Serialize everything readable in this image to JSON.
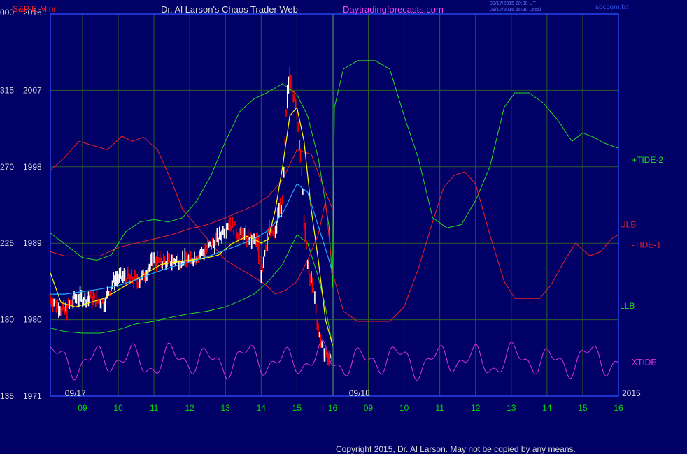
{
  "header": {
    "symbol": "S&P E-Mini",
    "title": "Dr. Al Larson's Chaos Trader Web",
    "site": "Daytradingforecasts.com",
    "timestamp_utc": "09/17/2015 20:30 UT",
    "timestamp_local": "09/17/2015 15:30 Local",
    "filename": "spccom.txt"
  },
  "footer": {
    "copyright": "Copyright 2015, Dr. Al Larson. May not be copied by any means."
  },
  "colors": {
    "background": "#000066",
    "grid": "#2e5b2e",
    "frame": "#2244ee",
    "price_up": "#ffffff",
    "price_down": "#ff0000",
    "tide_plus": "#22dd22",
    "tide_minus": "#ee2222",
    "xtide": "#dd33dd",
    "ulb": "#ee2222",
    "llb": "#22dd22",
    "ma_slow": "#ffff00",
    "ma_fast": "#22aaff",
    "axis_text": "#dddddd",
    "hour_text": "#00dd00",
    "title_text": "#dddddd",
    "symbol_text": "#ff2222",
    "site_text": "#ff44ff"
  },
  "chart_data": {
    "type": "line",
    "title": "Dr. Al Larson's Chaos Trader Web",
    "y_left_outer": [
      {
        "label": "000",
        "price": 2016
      },
      {
        "label": "315",
        "price": 2007
      },
      {
        "label": "270",
        "price": 1998
      },
      {
        "label": "225",
        "price": 1989
      },
      {
        "label": "180",
        "price": 1980
      },
      {
        "label": "135",
        "price": 1971
      }
    ],
    "y_ticks": [
      2016,
      2007,
      1998,
      1989,
      1980,
      1971
    ],
    "ylim": [
      1971,
      2016
    ],
    "x_hours": [
      "09",
      "10",
      "11",
      "12",
      "13",
      "14",
      "15",
      "16",
      "09",
      "10",
      "11",
      "12",
      "13",
      "14",
      "15",
      "16"
    ],
    "x_hours_pos": [
      1,
      2,
      3,
      4,
      5,
      6,
      7,
      8,
      9,
      10,
      11,
      12,
      13,
      14,
      15,
      16
    ],
    "xlim": [
      0.1,
      16.0
    ],
    "day_labels": [
      {
        "label": "09/17",
        "x": 0.8
      },
      {
        "label": "09/18",
        "x": 8.75
      }
    ],
    "day_divider_x": 8.02,
    "year_label": "2015",
    "series": [
      {
        "name": "+TIDE-2",
        "color": "#22dd22",
        "x": [
          0.1,
          0.6,
          1.0,
          1.4,
          1.8,
          2.2,
          2.6,
          3.0,
          3.4,
          3.8,
          4.2,
          4.6,
          5.0,
          5.4,
          5.8,
          6.2,
          6.6,
          7.0,
          7.3,
          7.6,
          7.9,
          8.0,
          8.05,
          8.3,
          8.7,
          9.2,
          9.6,
          10.0,
          10.4,
          10.8,
          11.2,
          11.6,
          12.0,
          12.4,
          12.8,
          13.1,
          13.5,
          13.9,
          14.3,
          14.7,
          15.0,
          15.3,
          15.6,
          16.0
        ],
        "y": [
          1990.2,
          1988.6,
          1987.3,
          1987.0,
          1987.6,
          1990.3,
          1991.5,
          1991.8,
          1991.5,
          1992.0,
          1994.0,
          1997.0,
          2001.0,
          2004.5,
          2006.0,
          2006.8,
          2007.8,
          2006.5,
          2004.0,
          1999.0,
          1991.0,
          1983.8,
          2005.0,
          2009.5,
          2010.5,
          2010.5,
          2009.5,
          2004.0,
          1999.0,
          1992.0,
          1990.8,
          1991.2,
          1994.0,
          1998.0,
          2005.0,
          2006.7,
          2006.7,
          2005.5,
          2003.5,
          2001.0,
          2002.0,
          2001.5,
          2000.8,
          2000.2
        ]
      },
      {
        "name": "-TIDE-1",
        "color": "#ee2222",
        "x": [
          0.1,
          0.5,
          0.9,
          1.3,
          1.7,
          2.1,
          2.4,
          2.7,
          3.1,
          3.5,
          3.8,
          4.2,
          4.6,
          5.0,
          5.4,
          5.8,
          6.1,
          6.4,
          6.7,
          7.0,
          7.3,
          7.6,
          7.8,
          8.0,
          8.3,
          8.7,
          9.2,
          9.6,
          10.0,
          10.4,
          10.8,
          11.1,
          11.4,
          11.7,
          12.0,
          12.4,
          12.8,
          13.1,
          13.5,
          13.8,
          14.1,
          14.5,
          14.8,
          15.2,
          15.5,
          15.8,
          16.0
        ],
        "y": [
          1997.6,
          1999.1,
          2001.0,
          2000.5,
          2000.0,
          2001.6,
          2001.0,
          2001.5,
          2000.0,
          1996.2,
          1993.0,
          1991.0,
          1989.0,
          1987.0,
          1986.0,
          1985.0,
          1984.2,
          1983.0,
          1983.5,
          1984.5,
          1987.0,
          1990.0,
          1994.0,
          1985.5,
          1981.0,
          1979.8,
          1979.8,
          1979.8,
          1981.5,
          1986.0,
          1991.5,
          1995.5,
          1997.0,
          1997.4,
          1996.0,
          1990.0,
          1984.5,
          1982.5,
          1982.5,
          1982.5,
          1984.0,
          1987.0,
          1989.0,
          1987.5,
          1988.0,
          1989.5,
          1990.0
        ]
      },
      {
        "name": "XTIDE",
        "color": "#dd33dd",
        "shape": "oscillator",
        "baseline": 1975.2,
        "amplitude": 2.4,
        "x_start": 0.1,
        "x_end": 16.0
      },
      {
        "name": "ULB",
        "color": "#ee2222",
        "x": [
          0.1,
          0.5,
          1.0,
          1.5,
          2.0,
          2.5,
          3.0,
          3.5,
          4.0,
          4.5,
          5.0,
          5.4,
          5.8,
          6.2,
          6.6,
          7.0,
          7.4,
          7.8,
          8.0
        ],
        "y": [
          1988.0,
          1987.5,
          1987.5,
          1987.5,
          1988.5,
          1989.0,
          1989.5,
          1990.0,
          1990.7,
          1991.2,
          1992.0,
          1992.7,
          1993.4,
          1994.5,
          1996.5,
          2000.0,
          1999.5,
          1995.0,
          1993.0
        ]
      },
      {
        "name": "LLB",
        "color": "#22dd22",
        "x": [
          0.1,
          0.5,
          1.0,
          1.5,
          2.0,
          2.5,
          3.0,
          3.5,
          4.0,
          4.5,
          5.0,
          5.4,
          5.8,
          6.2,
          6.6,
          7.0,
          7.3,
          7.6,
          7.8,
          8.0
        ],
        "y": [
          1979.0,
          1978.6,
          1978.4,
          1978.4,
          1978.8,
          1979.5,
          1979.8,
          1980.3,
          1980.7,
          1981.0,
          1981.5,
          1982.2,
          1983.0,
          1984.5,
          1986.5,
          1990.0,
          1989.0,
          1985.0,
          1981.5,
          1976.8
        ]
      },
      {
        "name": "MA slow",
        "color": "#ffff00",
        "x": [
          0.1,
          0.4,
          0.8,
          1.2,
          1.6,
          2.0,
          2.4,
          2.8,
          3.2,
          3.6,
          4.0,
          4.4,
          4.8,
          5.2,
          5.6,
          5.8,
          6.0,
          6.2,
          6.4,
          6.6,
          6.8,
          7.0,
          7.2,
          7.4,
          7.6,
          7.8,
          8.0
        ],
        "y": [
          1985.5,
          1982.0,
          1981.5,
          1982.0,
          1982.5,
          1983.5,
          1984.5,
          1985.5,
          1986.5,
          1986.8,
          1987.0,
          1987.2,
          1987.6,
          1989.0,
          1989.8,
          1989.5,
          1989.0,
          1989.5,
          1993.0,
          1998.0,
          2004.0,
          2005.0,
          2001.0,
          1993.0,
          1987.0,
          1980.0,
          1977.0
        ]
      },
      {
        "name": "MA fast",
        "color": "#22aaff",
        "x": [
          0.1,
          0.5,
          1.0,
          1.5,
          2.0,
          2.5,
          3.0,
          3.5,
          4.0,
          4.5,
          5.0,
          5.4,
          5.8,
          6.2,
          6.6,
          7.0,
          7.3,
          7.6,
          7.9,
          8.0
        ],
        "y": [
          1983.0,
          1983.0,
          1983.3,
          1983.6,
          1984.0,
          1984.7,
          1985.5,
          1986.2,
          1986.8,
          1987.4,
          1988.2,
          1988.8,
          1989.5,
          1990.5,
          1992.5,
          1996.0,
          1995.0,
          1991.0,
          1987.0,
          1985.5
        ]
      },
      {
        "name": "Price",
        "type": "bars",
        "x": [
          0.1,
          0.5,
          0.8,
          1.2,
          1.6,
          1.9,
          2.2,
          2.6,
          3.0,
          3.3,
          3.7,
          4.0,
          4.4,
          4.8,
          5.1,
          5.4,
          5.7,
          5.9,
          6.0,
          6.2,
          6.4,
          6.5,
          6.6,
          6.7,
          6.8,
          6.9,
          7.0,
          7.1,
          7.2,
          7.3,
          7.4,
          7.5,
          7.6,
          7.7,
          7.8,
          7.9,
          8.0
        ],
        "y": [
          1982.5,
          1981.0,
          1982.5,
          1982.5,
          1982.0,
          1984.8,
          1985.0,
          1984.5,
          1987.0,
          1986.8,
          1987.0,
          1987.0,
          1988.0,
          1989.5,
          1991.5,
          1990.0,
          1989.5,
          1989.0,
          1985.5,
          1990.5,
          1990.0,
          1993.0,
          1993.5,
          2004.0,
          2009.5,
          2006.5,
          2004.5,
          1999.5,
          1992.0,
          1986.5,
          1984.5,
          1982.5,
          1978.5,
          1977.0,
          1976.0,
          1975.5,
          1974.5
        ]
      }
    ],
    "series_labels": [
      {
        "name": "+TIDE-2",
        "price": 1998.8,
        "color": "#22dd22"
      },
      {
        "name": "ULB",
        "price": 1991.2,
        "color": "#ee2222"
      },
      {
        "name": "-TIDE-1",
        "price": 1988.8,
        "color": "#ee2222"
      },
      {
        "name": "LLB",
        "price": 1981.6,
        "color": "#22dd22"
      },
      {
        "name": "XTIDE",
        "price": 1975.0,
        "color": "#dd33dd"
      }
    ],
    "grid": true
  }
}
